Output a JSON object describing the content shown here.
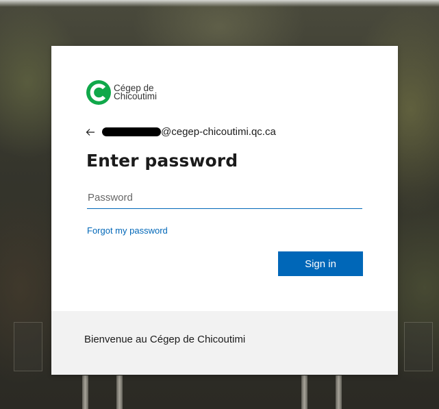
{
  "logo": {
    "name_line1": "Cégep de",
    "name_line2": "Chicoutimi",
    "icon": "cegep-logo-icon",
    "brand_color": "#10a84a"
  },
  "identity": {
    "back_icon": "arrow-left-icon",
    "email_suffix": "@cegep-chicoutimi.qc.ca"
  },
  "title": "Enter password",
  "password_field": {
    "placeholder": "Password",
    "value": ""
  },
  "forgot_link": "Forgot my password",
  "sign_in_label": "Sign in",
  "footer_text": "Bienvenue au Cégep de Chicoutimi",
  "colors": {
    "accent": "#0067b8",
    "footer_bg": "#f2f2f2"
  }
}
